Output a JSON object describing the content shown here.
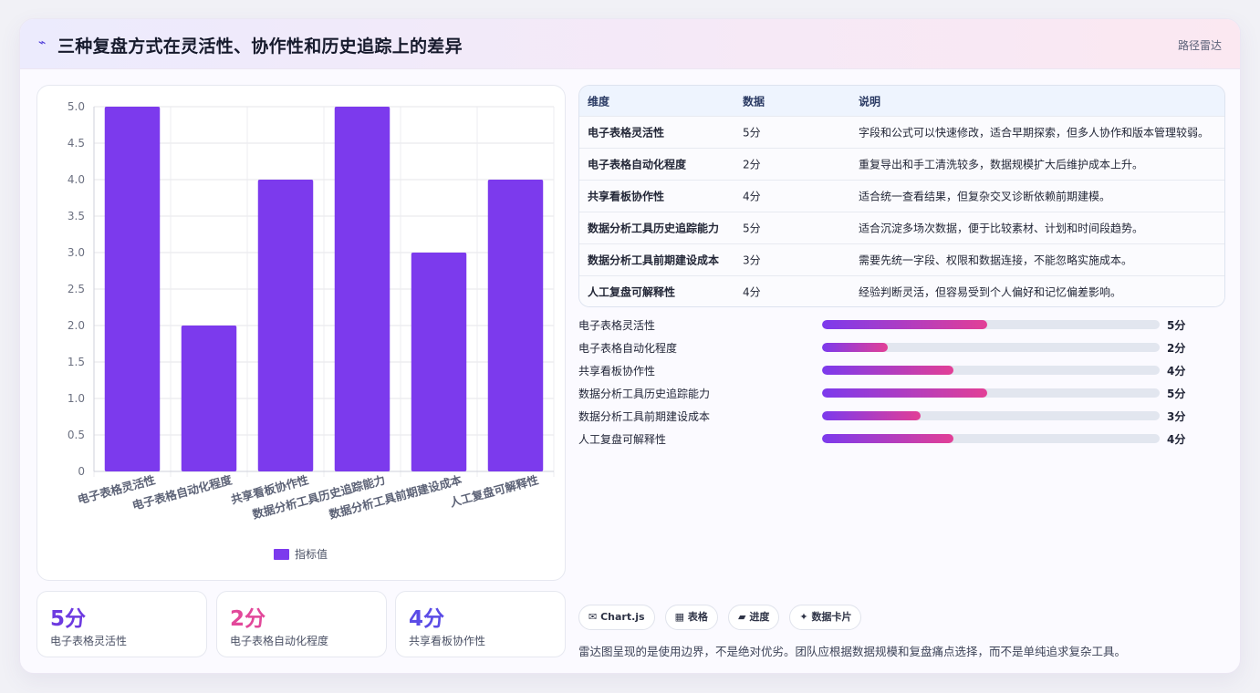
{
  "header": {
    "icon": "bolt-icon",
    "title": "三种复盘方式在灵活性、协作性和历史追踪上的差异",
    "tag": "路径雷达"
  },
  "chart_data": {
    "type": "bar",
    "categories": [
      "电子表格灵活性",
      "电子表格自动化程度",
      "共享看板协作性",
      "数据分析工具历史追踪能力",
      "数据分析工具前期建设成本",
      "人工复盘可解释性"
    ],
    "series": [
      {
        "name": "指标值",
        "values": [
          5,
          2,
          4,
          5,
          3,
          4
        ],
        "color": "#7c3aed"
      }
    ],
    "ylim": [
      0,
      5
    ],
    "yticks": [
      "0",
      "0.5",
      "1.0",
      "1.5",
      "2.0",
      "2.5",
      "3.0",
      "3.5",
      "4.0",
      "4.5",
      "5.0"
    ],
    "grid": true,
    "legend": "bottom"
  },
  "kpis": [
    {
      "value": "5分",
      "label": "电子表格灵活性",
      "color": "#6d3ae0"
    },
    {
      "value": "2分",
      "label": "电子表格自动化程度",
      "color": "#e2489a"
    },
    {
      "value": "4分",
      "label": "共享看板协作性",
      "color": "#5b4ce6"
    }
  ],
  "table": {
    "headers": [
      "维度",
      "数据",
      "说明"
    ],
    "rows": [
      [
        "电子表格灵活性",
        "5分",
        "字段和公式可以快速修改，适合早期探索，但多人协作和版本管理较弱。"
      ],
      [
        "电子表格自动化程度",
        "2分",
        "重复导出和手工清洗较多，数据规模扩大后维护成本上升。"
      ],
      [
        "共享看板协作性",
        "4分",
        "适合统一查看结果，但复杂交叉诊断依赖前期建模。"
      ],
      [
        "数据分析工具历史追踪能力",
        "5分",
        "适合沉淀多场次数据，便于比较素材、计划和时间段趋势。"
      ],
      [
        "数据分析工具前期建设成本",
        "3分",
        "需要先统一字段、权限和数据连接，不能忽略实施成本。"
      ],
      [
        "人工复盘可解释性",
        "4分",
        "经验判断灵活，但容易受到个人偏好和记忆偏差影响。"
      ]
    ]
  },
  "progress": [
    {
      "label": "电子表格灵活性",
      "value": "5分",
      "fraction": 0.49
    },
    {
      "label": "电子表格自动化程度",
      "value": "2分",
      "fraction": 0.195
    },
    {
      "label": "共享看板协作性",
      "value": "4分",
      "fraction": 0.39
    },
    {
      "label": "数据分析工具历史追踪能力",
      "value": "5分",
      "fraction": 0.49
    },
    {
      "label": "数据分析工具前期建设成本",
      "value": "3分",
      "fraction": 0.292
    },
    {
      "label": "人工复盘可解释性",
      "value": "4分",
      "fraction": 0.39
    }
  ],
  "chips": [
    {
      "icon": "✉",
      "label": "Chart.js"
    },
    {
      "icon": "▦",
      "label": "表格"
    },
    {
      "icon": "▰",
      "label": "进度"
    },
    {
      "icon": "✦",
      "label": "数据卡片"
    }
  ],
  "note": "雷达图呈现的是使用边界，不是绝对优劣。团队应根据数据规模和复盘痛点选择，而不是单纯追求复杂工具。"
}
